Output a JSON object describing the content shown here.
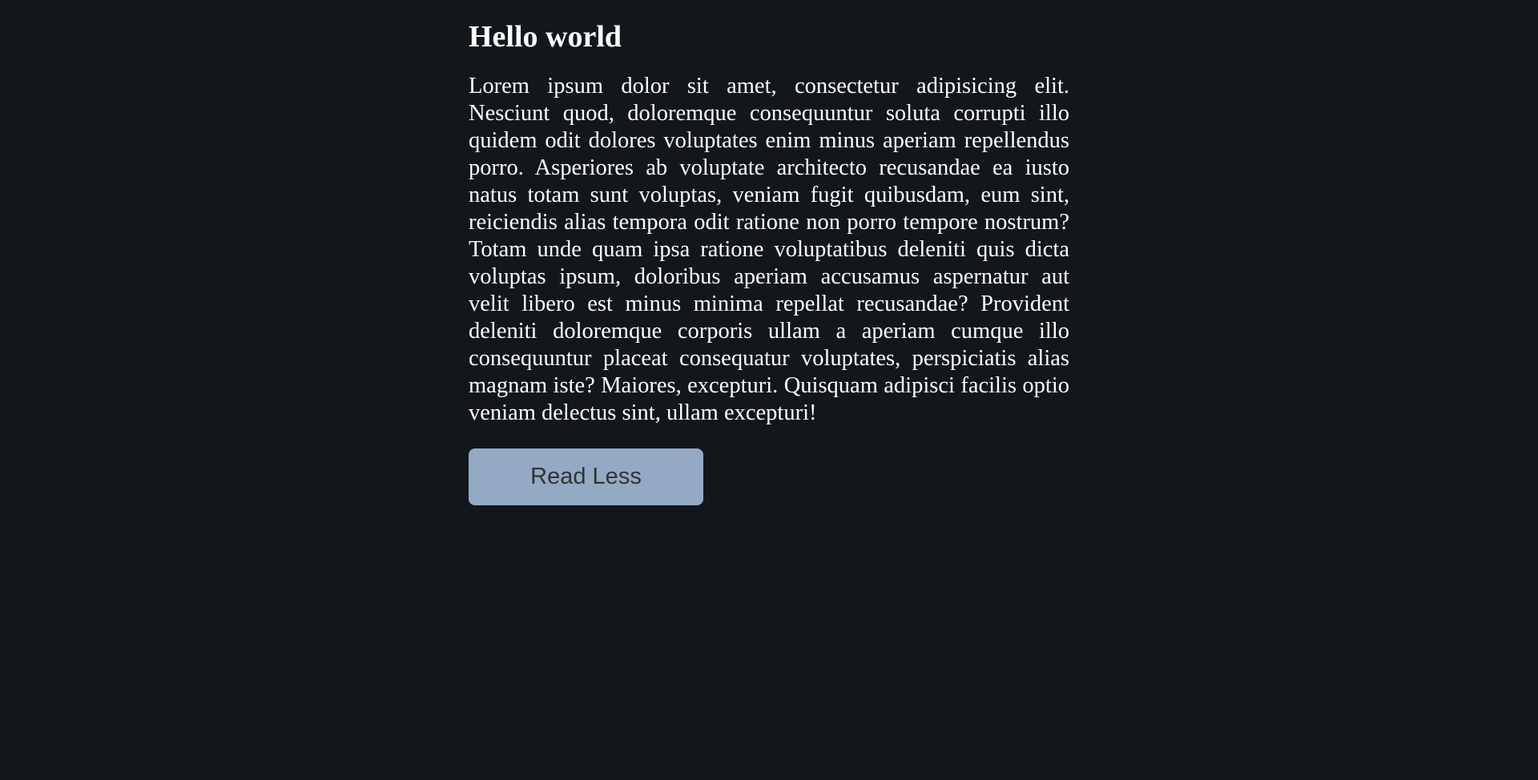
{
  "heading": "Hello world",
  "paragraph": "Lorem ipsum dolor sit amet, consectetur adipisicing elit. Nesciunt quod, doloremque consequuntur soluta corrupti illo quidem odit dolores voluptates enim minus aperiam repellendus porro. Asperiores ab voluptate architecto recusandae ea iusto natus totam sunt voluptas, veniam fugit quibusdam, eum sint, reiciendis alias tempora odit ratione non porro tempore nostrum? Totam unde quam ipsa ratione voluptatibus deleniti quis dicta voluptas ipsum, doloribus aperiam accusamus aspernatur aut velit libero est minus minima repellat recusandae? Provident deleniti doloremque corporis ullam a aperiam cumque illo consequuntur placeat consequatur voluptates, perspiciatis alias magnam iste? Maiores, excepturi. Quisquam adipisci facilis optio veniam delectus sint, ullam excepturi!",
  "button_label": "Read Less",
  "colors": {
    "background": "#12171c",
    "button": "#94a9c4"
  }
}
